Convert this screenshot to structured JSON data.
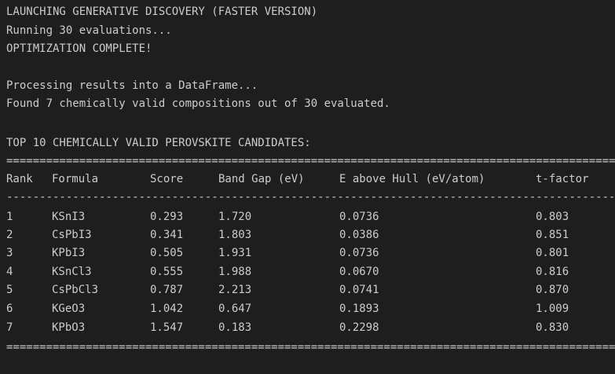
{
  "log": [
    "LAUNCHING GENERATIVE DISCOVERY (FASTER VERSION)",
    "Running 30 evaluations...",
    "OPTIMIZATION COMPLETE!",
    "",
    "Processing results into a DataFrame...",
    "Found 7 chemically valid compositions out of 30 evaluated.",
    "",
    "TOP 10 CHEMICALLY VALID PEROVSKITE CANDIDATES:"
  ],
  "rules": {
    "double": "==========================================================================================================",
    "single": "----------------------------------------------------------------------------------------------------------"
  },
  "table": {
    "headers": [
      "Rank",
      "Formula",
      "Score",
      "Band Gap (eV)",
      "E above Hull (eV/atom)",
      "t-factor"
    ],
    "rows": [
      [
        "1",
        "KSnI3",
        "0.293",
        "1.720",
        "0.0736",
        "0.803"
      ],
      [
        "2",
        "CsPbI3",
        "0.341",
        "1.803",
        "0.0386",
        "0.851"
      ],
      [
        "3",
        "KPbI3",
        "0.505",
        "1.931",
        "0.0736",
        "0.801"
      ],
      [
        "4",
        "KSnCl3",
        "0.555",
        "1.988",
        "0.0670",
        "0.816"
      ],
      [
        "5",
        "CsPbCl3",
        "0.787",
        "2.213",
        "0.0741",
        "0.870"
      ],
      [
        "6",
        "KGeO3",
        "1.042",
        "0.647",
        "0.1893",
        "1.009"
      ],
      [
        "7",
        "KPbO3",
        "1.547",
        "0.183",
        "0.2298",
        "0.830"
      ]
    ]
  },
  "colors": {
    "background": "#1e1e1e",
    "text": "#cccccc"
  }
}
